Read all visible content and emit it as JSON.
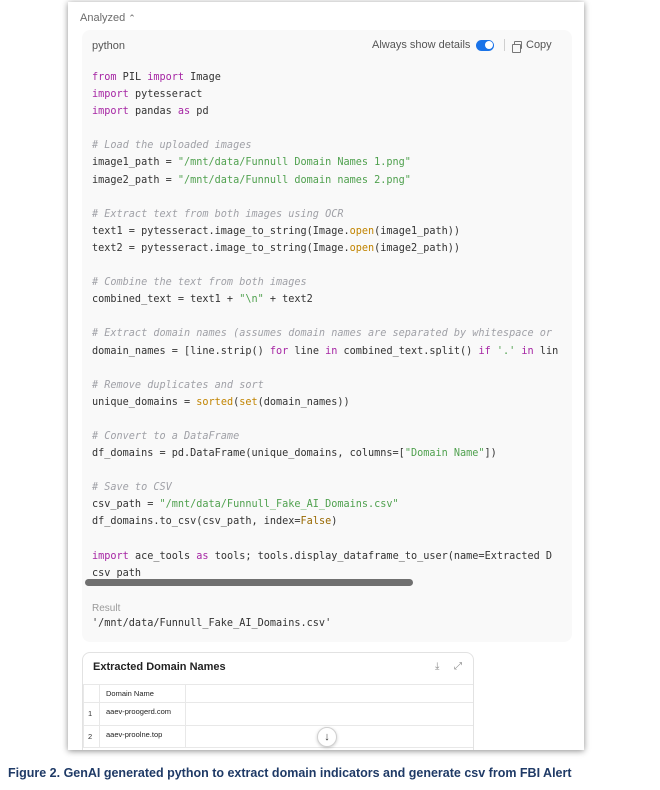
{
  "header": {
    "analyzed_label": "Analyzed"
  },
  "code_block": {
    "language": "python",
    "details_label": "Always show details",
    "copy_label": "Copy",
    "lines": [
      "from PIL import Image",
      "import pytesseract",
      "import pandas as pd",
      "",
      "# Load the uploaded images",
      "image1_path = \"/mnt/data/Funnull Domain Names 1.png\"",
      "image2_path = \"/mnt/data/Funnull domain names 2.png\"",
      "",
      "# Extract text from both images using OCR",
      "text1 = pytesseract.image_to_string(Image.open(image1_path))",
      "text2 = pytesseract.image_to_string(Image.open(image2_path))",
      "",
      "# Combine the text from both images",
      "combined_text = text1 + \"\\n\" + text2",
      "",
      "# Extract domain names (assumes domain names are separated by whitespace or",
      "domain_names = [line.strip() for line in combined_text.split() if '.' in lin",
      "",
      "# Remove duplicates and sort",
      "unique_domains = sorted(set(domain_names))",
      "",
      "# Convert to a DataFrame",
      "df_domains = pd.DataFrame(unique_domains, columns=[\"Domain Name\"])",
      "",
      "# Save to CSV",
      "csv_path = \"/mnt/data/Funnull_Fake_AI_Domains.csv\"",
      "df_domains.to_csv(csv_path, index=False)",
      "",
      "import ace_tools as tools; tools.display_dataframe_to_user(name=\"Extracted D",
      "csv_path"
    ]
  },
  "result": {
    "label": "Result",
    "value": "'/mnt/data/Funnull_Fake_AI_Domains.csv'"
  },
  "table": {
    "title": "Extracted Domain Names",
    "column_header": "Domain Name",
    "rows": [
      {
        "index": "1",
        "domain": "aaev-proogerd.com"
      },
      {
        "index": "2",
        "domain": "aaev-proolne.top"
      }
    ]
  },
  "icons": {
    "analyzed_chevron": "chevron-up-icon",
    "copy": "copy-icon",
    "download": "download-icon",
    "expand": "expand-icon",
    "scroll_down": "arrow-down-icon"
  },
  "colors": {
    "toggle_on": "#1a73e8",
    "keyword": "#a626a4",
    "string": "#50a14f",
    "comment": "#a0a1a7",
    "caption": "#1f3a66"
  },
  "caption": "Figure 2. GenAI generated python to extract domain indicators and generate csv from FBI Alert"
}
